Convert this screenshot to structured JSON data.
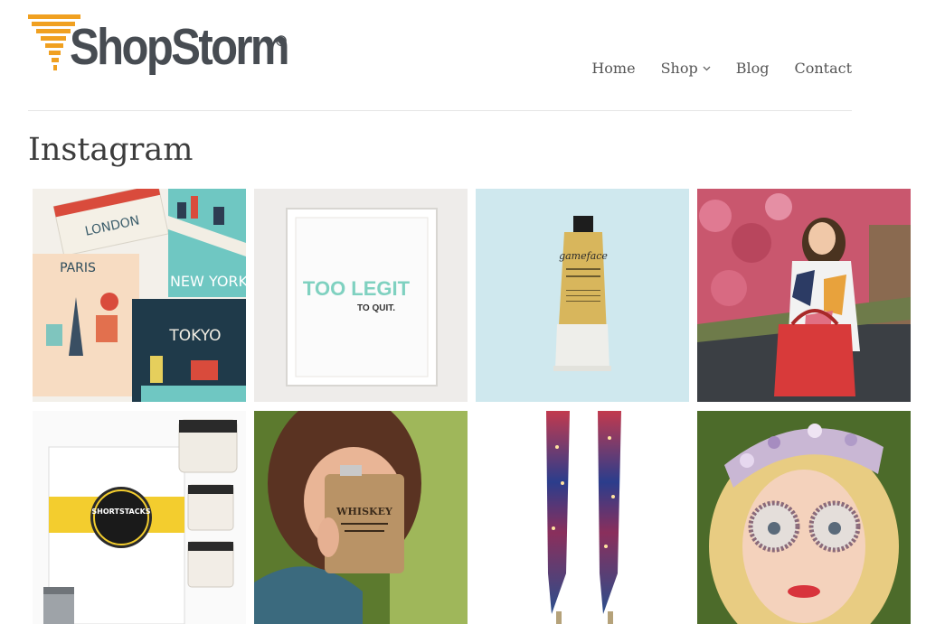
{
  "brand": {
    "name": "ShopStorm",
    "registered": "®",
    "colors": {
      "logo_orange": "#f0a020",
      "logo_text": "#474c52"
    }
  },
  "nav": {
    "items": [
      {
        "label": "Home"
      },
      {
        "label": "Shop"
      },
      {
        "label": "Blog"
      },
      {
        "label": "Contact"
      }
    ]
  },
  "page": {
    "title": "Instagram"
  },
  "instagram": {
    "tiles": [
      {
        "maps": [
          "LONDON",
          "PARIS",
          "NEW YORK",
          "TOKYO"
        ]
      },
      {
        "print_line1": "TOO LEGIT",
        "print_line2": "TO QUIT."
      },
      {
        "tube_brand": "gameface"
      },
      {
        "description_icon": "photo-icon"
      },
      {
        "box_label": "SHORTSTACKS"
      },
      {
        "flask_label": "WHISKEY"
      },
      {
        "description_icon": "photo-icon"
      },
      {
        "description_icon": "photo-icon"
      }
    ]
  }
}
